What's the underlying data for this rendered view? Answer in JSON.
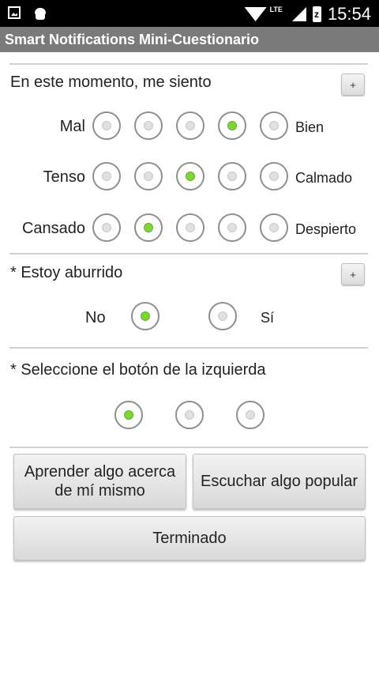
{
  "status_bar": {
    "time": "15:54",
    "network": "LTE",
    "icons": [
      "image-icon",
      "android-icon",
      "wifi-icon",
      "signal-icon",
      "battery-icon"
    ]
  },
  "app_title": "Smart Notifications Mini-Cuestionario",
  "questions": {
    "mood": {
      "title": "En este momento, me siento",
      "expand_label": "+",
      "rows": [
        {
          "left": "Mal",
          "right": "Bien",
          "selected": 4
        },
        {
          "left": "Tenso",
          "right": "Calmado",
          "selected": 3
        },
        {
          "left": "Cansado",
          "right": "Despierto",
          "selected": 2
        }
      ]
    },
    "bored": {
      "title": "* Estoy aburrido",
      "expand_label": "+",
      "no_label": "No",
      "yes_label": "Sí",
      "selected": "No"
    },
    "left_button": {
      "title": "* Seleccione el botón de la izquierda",
      "selected": 1
    }
  },
  "actions": {
    "learn_self": "Aprender algo acerca de mí mismo",
    "listen_popular": "Escuchar algo popular",
    "done": "Terminado"
  },
  "colors": {
    "radio_selected": "#7fd43a",
    "title_bar": "#7a7a7a",
    "status_bar": "#000000"
  }
}
